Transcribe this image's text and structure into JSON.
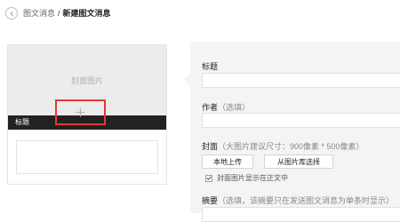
{
  "header": {
    "back_icon": "chevron-left-icon",
    "breadcrumb_prev": "图文消息",
    "breadcrumb_sep": "/",
    "breadcrumb_current": "新建图文消息"
  },
  "preview": {
    "cover_placeholder": "封面图片",
    "title_label": "标题",
    "add_icon": "plus-icon"
  },
  "form": {
    "title_label": "标题",
    "title_value": "",
    "author_label": "作者",
    "author_hint": "（选填）",
    "author_value": "",
    "cover_label": "封面",
    "cover_hint": "（大图片建议尺寸：900像素 * 500像素）",
    "upload_local": "本地上传",
    "choose_from_library": "从图片库选择",
    "show_cover_in_body": "封面图片显示在正文中",
    "show_cover_checked": true,
    "summary_label": "摘要",
    "summary_hint": "（选填，该摘要只在发送图文消息为单条时显示）"
  },
  "colors": {
    "highlight": "#e53935",
    "title_bar": "#222222",
    "panel_bg": "#f4f4f4"
  }
}
